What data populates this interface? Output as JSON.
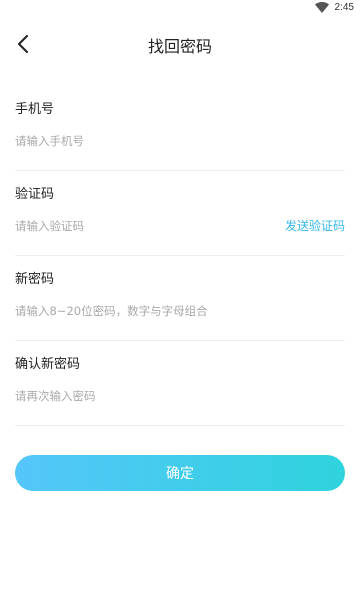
{
  "status_bar": {
    "time": "2:45",
    "icons": [
      "wifi-icon"
    ]
  },
  "header": {
    "title": "找回密码",
    "back_icon": "chevron-left-icon"
  },
  "form": {
    "phone": {
      "label": "手机号",
      "placeholder": "请输入手机号",
      "value": ""
    },
    "code": {
      "label": "验证码",
      "placeholder": "请输入验证码",
      "value": "",
      "send_label": "发送验证码"
    },
    "new_password": {
      "label": "新密码",
      "placeholder": "请输入8~20位密码，数字与字母组合",
      "value": ""
    },
    "confirm_password": {
      "label": "确认新密码",
      "placeholder": "请再次输入密码",
      "value": ""
    }
  },
  "submit": {
    "label": "确定"
  },
  "colors": {
    "accent": "#35b7e6",
    "button_start": "#55c6fa",
    "button_end": "#2fd3dd"
  }
}
